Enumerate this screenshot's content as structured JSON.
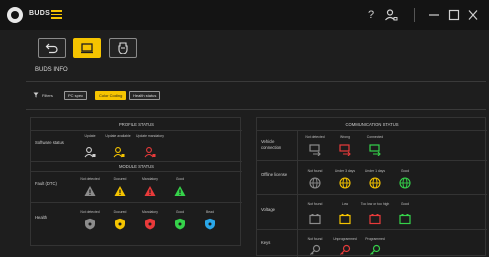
{
  "app": {
    "title": "BUDS"
  },
  "page": {
    "section_title": "BUDS INFO"
  },
  "filters": {
    "label": "Filters",
    "chips": [
      "PC spec",
      "Color Coding",
      "Health status"
    ],
    "selected": "Color Coding"
  },
  "profile_status": {
    "title": "PROFILE STATUS",
    "row_label": "Software status",
    "columns": [
      "Update",
      "Update available",
      "Update mandatory"
    ]
  },
  "module_status": {
    "title": "MODULE STATUS",
    "fault_row": {
      "label": "Fault (DTC)",
      "columns": [
        "Not detected",
        "Docured",
        "Mandatory",
        "Good"
      ]
    },
    "health_row": {
      "label": "Health",
      "columns": [
        "Not detected",
        "Docured",
        "Mandatory",
        "Good",
        "Bead"
      ]
    }
  },
  "communication_status": {
    "title": "COMMUNICATION STATUS",
    "vehicle_connection": {
      "label": "Vehicle connection",
      "columns": [
        "Not detected",
        "Wrong",
        "Connected"
      ]
    },
    "offline_license": {
      "label": "Offline license",
      "columns": [
        "Not found",
        "Under 3 days",
        "Under 1 days",
        "Good"
      ]
    },
    "voltage": {
      "label": "Voltage",
      "columns": [
        "Not found",
        "Low",
        "Too low or too high",
        "Good"
      ]
    },
    "keys": {
      "label": "Keys",
      "columns": [
        "Not found",
        "Unprogrammed",
        "Programmed"
      ]
    }
  },
  "colors": {
    "accent": "#f5c400",
    "grey": "#8c8c8c",
    "yellow": "#f5c400",
    "red": "#e83a3a",
    "green": "#35d24a",
    "blue": "#2aa7e8"
  }
}
